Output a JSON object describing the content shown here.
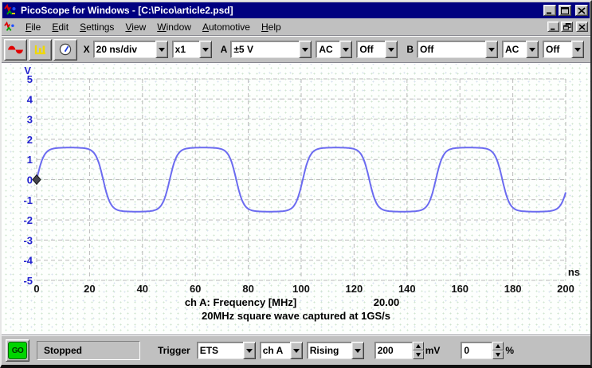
{
  "window": {
    "title": "PicoScope for Windows - [C:\\Pico\\article2.psd]",
    "title_buttons": [
      "minimize",
      "maximize",
      "close"
    ],
    "mdi_buttons": [
      "minimize",
      "restore",
      "close"
    ]
  },
  "menu": {
    "items": [
      {
        "label": "File"
      },
      {
        "label": "Edit"
      },
      {
        "label": "Settings"
      },
      {
        "label": "View"
      },
      {
        "label": "Window"
      },
      {
        "label": "Automotive"
      },
      {
        "label": "Help"
      }
    ]
  },
  "toolbar": {
    "view_buttons": [
      {
        "name": "scope-view",
        "icon": "sine-wave-icon"
      },
      {
        "name": "spectrum-view",
        "icon": "spectrum-bars-icon"
      },
      {
        "name": "meter-view",
        "icon": "meter-dial-icon"
      }
    ],
    "x_label": "X",
    "timebase": "20 ns/div",
    "multiplier": "x1",
    "a_label": "A",
    "a_range": "±5 V",
    "a_coupling": "AC",
    "a_alt": "Off",
    "b_label": "B",
    "b_range": "Off",
    "b_coupling": "AC",
    "b_alt": "Off"
  },
  "statusbar": {
    "go_label": "GO",
    "status": "Stopped",
    "trigger_label": "Trigger",
    "trigger_mode": "ETS",
    "trigger_source": "ch A",
    "trigger_direction": "Rising",
    "threshold_value": "200",
    "threshold_unit": "mV",
    "delay_value": "0",
    "delay_unit": "%"
  },
  "colors": {
    "titlebar": "#000080",
    "go_button": "#00d400",
    "waveform": "#6b6bf0",
    "axis_label_blue": "#2323cf",
    "grid": "#b9b9b9"
  },
  "chart_data": {
    "type": "line",
    "x_unit": "ns",
    "y_unit": "V",
    "xlim": [
      0,
      200
    ],
    "ylim": [
      -5,
      5
    ],
    "x_ticks": [
      0,
      20,
      40,
      60,
      80,
      100,
      120,
      140,
      160,
      180,
      200
    ],
    "y_ticks": [
      5,
      4,
      3,
      2,
      1,
      0,
      -1,
      -2,
      -3,
      -4,
      -5
    ],
    "grid": "dashed",
    "series": [
      {
        "name": "ch A",
        "color": "#6b6bf0",
        "shape": "smoothed-square",
        "amplitude_v": 1.6,
        "period_ns": 50.3,
        "phase_ns": 0,
        "edge_sharpness": 2.8
      }
    ],
    "trigger_marker": {
      "t_ns": 0,
      "v": 0,
      "color": "#45454d"
    },
    "measurements": [
      {
        "label": "ch A: Frequency [MHz]",
        "value": "20.00"
      }
    ],
    "caption": "20MHz square wave captured at 1GS/s",
    "colors": {
      "grid": "#b9b9b9",
      "x_labels": "#111111",
      "y_labels": "#2323cf"
    }
  }
}
